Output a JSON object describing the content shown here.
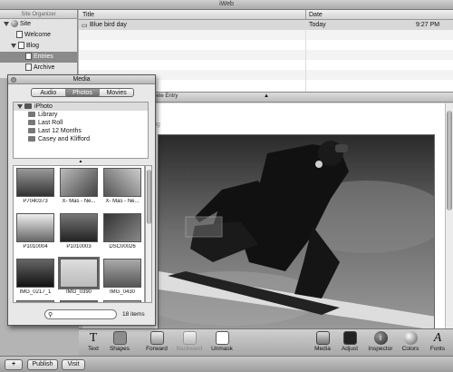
{
  "window": {
    "title": "iWeb"
  },
  "organizer": {
    "header": "Site Organizer",
    "site": "Site",
    "pages": [
      "Welcome"
    ],
    "blog": "Blog",
    "blog_children": [
      "Entries",
      "Archive"
    ],
    "selected": "Entries"
  },
  "entries": {
    "col_title": "Title",
    "col_date": "Date",
    "rows": [
      {
        "title": "Blue bird day",
        "date": "Today",
        "time": "9:27 PM"
      }
    ]
  },
  "editor": {
    "tab_label": "lete Entry",
    "faint_text": "og"
  },
  "toolbar": {
    "items": [
      {
        "label": "Text",
        "icon": "text-icon",
        "enabled": true
      },
      {
        "label": "Shapes",
        "icon": "shapes-icon",
        "enabled": true
      },
      {
        "label": "Forward",
        "icon": "forward-icon",
        "enabled": true
      },
      {
        "label": "Backward",
        "icon": "backward-icon",
        "enabled": false
      },
      {
        "label": "Unmask",
        "icon": "unmask-icon",
        "enabled": true
      },
      {
        "label": "Media",
        "icon": "media-icon",
        "enabled": true
      },
      {
        "label": "Adjust",
        "icon": "adjust-icon",
        "enabled": true
      },
      {
        "label": "Inspector",
        "icon": "inspector-icon",
        "enabled": true
      },
      {
        "label": "Colors",
        "icon": "colors-icon",
        "enabled": true
      },
      {
        "label": "Fonts",
        "icon": "fonts-icon",
        "enabled": true
      }
    ]
  },
  "statusbar": {
    "add": "+",
    "publish": "Publish",
    "visit": "Visit"
  },
  "media": {
    "title": "Media",
    "tabs": [
      "Audio",
      "Photos",
      "Movies"
    ],
    "active_tab": "Photos",
    "sources": {
      "root": "iPhoto",
      "items": [
        "Library",
        "Last Roll",
        "Last 12 Months",
        "Casey and Klifford"
      ]
    },
    "grip": "▲",
    "photos": [
      {
        "name": "P7040373",
        "selected": false
      },
      {
        "name": "X- Mas - Ne...",
        "selected": false
      },
      {
        "name": "X- Mas - Ne...",
        "selected": false
      },
      {
        "name": "P1010004",
        "selected": false
      },
      {
        "name": "P1010003",
        "selected": false
      },
      {
        "name": "DSC00026",
        "selected": false
      },
      {
        "name": "IMG_0217_1",
        "selected": false
      },
      {
        "name": "IMG_0390",
        "selected": true
      },
      {
        "name": "IMG_0430",
        "selected": false
      },
      {
        "name": "",
        "selected": false
      },
      {
        "name": "",
        "selected": false
      },
      {
        "name": "",
        "selected": false
      }
    ],
    "search_placeholder": "",
    "count": "18 items"
  }
}
